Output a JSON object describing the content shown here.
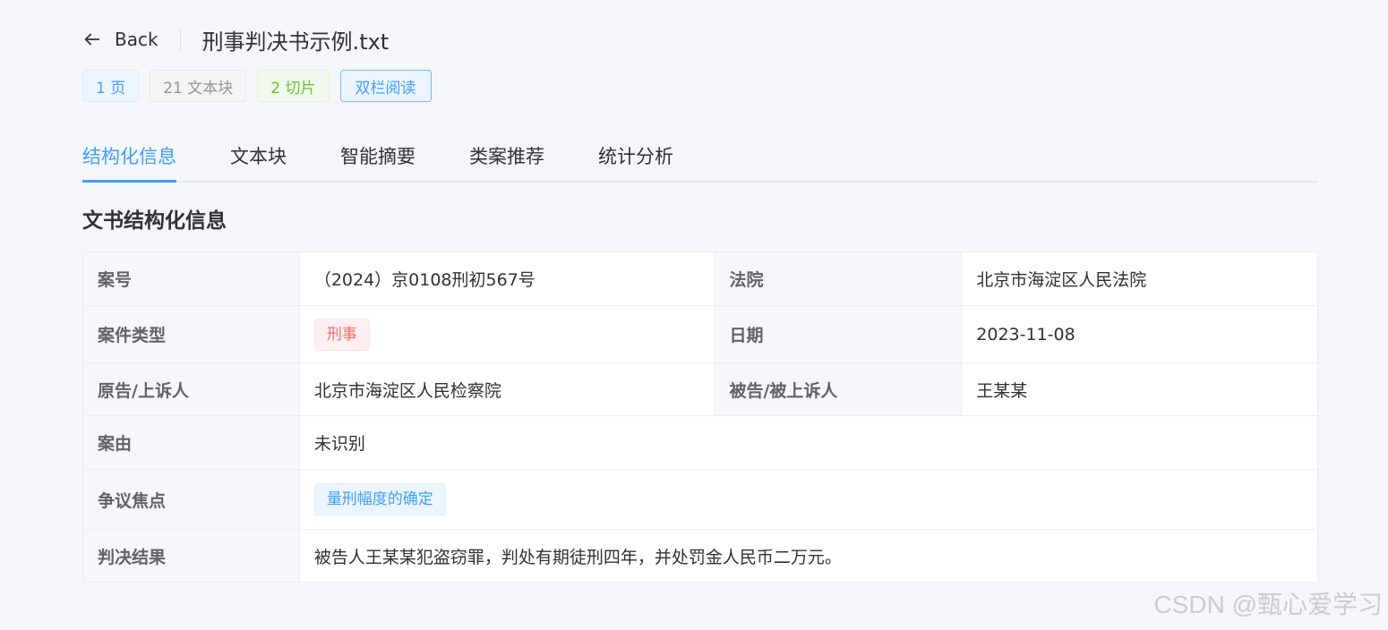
{
  "header": {
    "back_label": "Back",
    "file_title": "刑事判决书示例.txt"
  },
  "tags": {
    "pages": "1 页",
    "text_blocks": "21 文本块",
    "slices": "2 切片",
    "two_column_button": "双栏阅读"
  },
  "tabs": [
    {
      "label": "结构化信息",
      "active": true
    },
    {
      "label": "文本块",
      "active": false
    },
    {
      "label": "智能摘要",
      "active": false
    },
    {
      "label": "类案推荐",
      "active": false
    },
    {
      "label": "统计分析",
      "active": false
    }
  ],
  "section_title": "文书结构化信息",
  "info": {
    "case_no_label": "案号",
    "case_no_value": "（2024）京0108刑初567号",
    "court_label": "法院",
    "court_value": "北京市海淀区人民法院",
    "case_type_label": "案件类型",
    "case_type_value": "刑事",
    "date_label": "日期",
    "date_value": "2023-11-08",
    "plaintiff_label": "原告/上诉人",
    "plaintiff_value": "北京市海淀区人民检察院",
    "defendant_label": "被告/被上诉人",
    "defendant_value": "王某某",
    "cause_label": "案由",
    "cause_value": "未识别",
    "focus_label": "争议焦点",
    "focus_value": "量刑幅度的确定",
    "judgment_label": "判决结果",
    "judgment_value": "被告人王某某犯盗窃罪，判处有期徒刑四年，并处罚金人民币二万元。"
  },
  "watermark": "CSDN @甄心爱学习",
  "colors": {
    "accent": "#409eff",
    "danger": "#f56c6c",
    "success": "#67c23a",
    "background": "#f4f6fa"
  },
  "icons": {
    "back": "arrow-left-icon"
  }
}
